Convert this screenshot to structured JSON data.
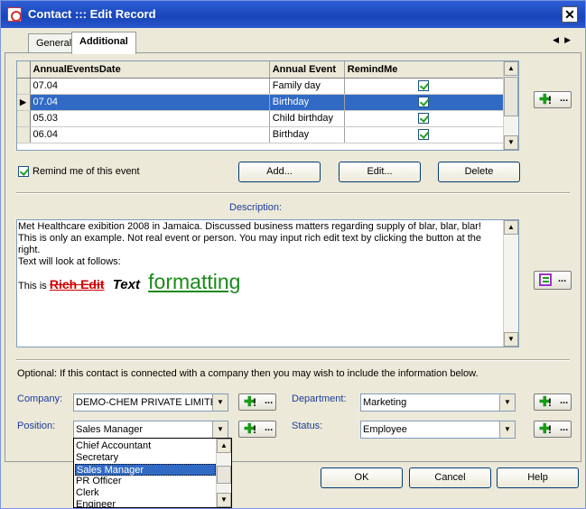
{
  "window": {
    "title": "Contact ::: Edit Record",
    "close_glyph": "✕"
  },
  "tabs": [
    {
      "label": "General"
    },
    {
      "label": "Additional"
    }
  ],
  "tab_nav": {
    "prev": "◀",
    "next": "▶"
  },
  "events_grid": {
    "columns": [
      "AnnualEventsDate",
      "Annual Event",
      "RemindMe"
    ],
    "rows": [
      {
        "date": "07.04",
        "event": "Family day",
        "remind": true
      },
      {
        "date": "07.04",
        "event": "Birthday",
        "remind": true
      },
      {
        "date": "05.03",
        "event": "Child birthday",
        "remind": true
      },
      {
        "date": "06.04",
        "event": "Birthday",
        "remind": true
      }
    ],
    "selected_row": 1
  },
  "remind_checkbox": {
    "label": "Remind me of this event",
    "checked": true
  },
  "buttons": {
    "add": "Add...",
    "edit": "Edit...",
    "delete": "Delete",
    "ok": "OK",
    "cancel": "Cancel",
    "help": "Help"
  },
  "add_button_parts": {
    "plus": "✚",
    "excl": "!",
    "dots": "..."
  },
  "description": {
    "label": "Description:",
    "lines": [
      "Met Healthcare exibition 2008 in Jamaica. Discussed business matters regarding supply of blar, blar, blar!",
      "This is only an example. Not real event or person. You may input rich edit text by clicking the button at the right.",
      "Text will look at follows:"
    ],
    "rich": {
      "prefix": "This is",
      "strike": "Rich Edit",
      "italic": "Text",
      "large": "formatting"
    }
  },
  "optional_note": "Optional: If this contact is connected with a company then you may wish to include the information below.",
  "fields": {
    "company": {
      "label": "Company:",
      "value": "DEMO-CHEM PRIVATE LIMITED"
    },
    "department": {
      "label": "Department:",
      "value": "Marketing"
    },
    "position": {
      "label": "Position:",
      "value": "Sales Manager"
    },
    "status": {
      "label": "Status:",
      "value": "Employee"
    }
  },
  "position_dropdown": {
    "options": [
      "Chief Accountant",
      "Secretary",
      "Sales Manager",
      "PR Officer",
      "Clerk",
      "Engineer"
    ],
    "selected_index": 2
  },
  "colors": {
    "title_bar": "#1845b8",
    "selection": "#316ac5",
    "accent_green": "#1a9b1a",
    "label_blue": "#1c3c9c",
    "rich_red": "#d00000",
    "rich_green": "#1a8a1a"
  }
}
